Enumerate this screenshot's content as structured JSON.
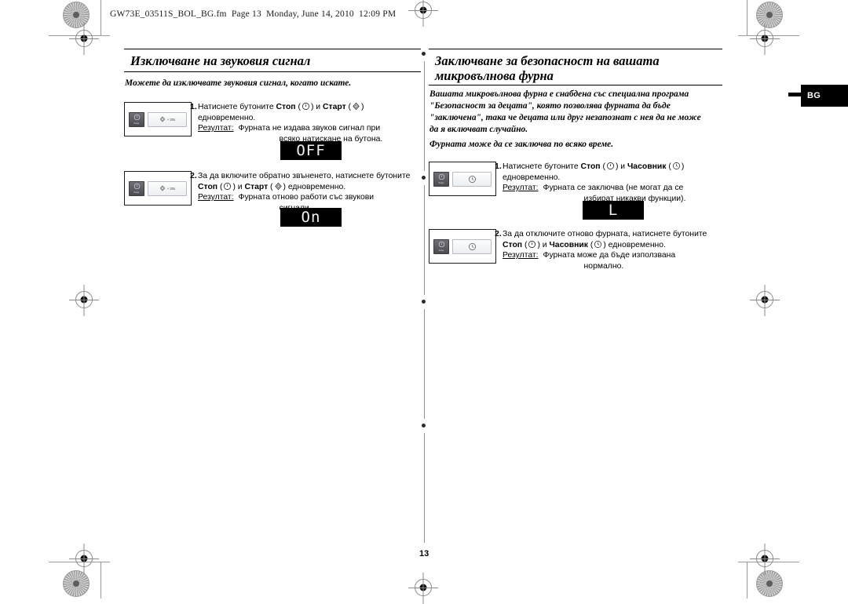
{
  "document": {
    "fm_header": "GW73E_03511S_BOL_BG.fm  Page 13  Monday, June 14, 2010  12:09 PM",
    "page_number": "13",
    "language_tab": "BG"
  },
  "left_column": {
    "title": "Изключване на звуковия сигнал",
    "lead": "Можете да изключвате звуковия сигнал, когато искате.",
    "steps": [
      {
        "number": "1.",
        "line1_pre": "Натиснете бутоните ",
        "btn1": "Стоп",
        "btn1_symbol": "stop-icon",
        "mid": " и ",
        "btn2": "Старт",
        "btn2_symbol": "start-icon",
        "line1_post": "",
        "line2": "едновременно.",
        "result_label": "Резултат:",
        "result_line1": "Фурната не издава звуков сигнал при",
        "result_line2": "всяко натискане на бутона.",
        "panel": {
          "stop_label": "Stop",
          "wide_label": "+ 30s",
          "wide_symbol": "start-icon"
        },
        "display": "OFF"
      },
      {
        "number": "2.",
        "line1_pre": "За да включите обратно звъненето, натиснете бутоните",
        "btn1": "Стоп",
        "btn1_symbol": "stop-icon",
        "mid": " и ",
        "btn2": "Старт",
        "btn2_symbol": "start-icon",
        "line1_post": " едновременно.",
        "line2": "",
        "result_label": "Резултат:",
        "result_line1": "Фурната отново работи със звукови",
        "result_line2": "сигнали.",
        "panel": {
          "stop_label": "Stop",
          "wide_label": "+ 30s",
          "wide_symbol": "start-icon"
        },
        "display": "On"
      }
    ]
  },
  "right_column": {
    "title_line1": "Заключване за безопасност на вашата",
    "title_line2": "микровълнова фурна",
    "lead_lines": [
      "Вашата микровълнова фурна е снабдена със специална програма",
      "\"Безопасност за децата\", която позволява фурната да бъде",
      "\"заключена\", така че децата или друг незапознат с нея да не може",
      "да я включват случайно."
    ],
    "lead2": "Фурната може да се заключва по всяко време.",
    "steps": [
      {
        "number": "1.",
        "line1_pre": "Натиснете бутоните ",
        "btn1": "Стоп",
        "btn1_symbol": "stop-icon",
        "mid": " и ",
        "btn2": "Часовник",
        "btn2_symbol": "clock-icon",
        "line1_post": "",
        "line2": "едновременно.",
        "result_label": "Резултат:",
        "result_line1": "Фурната се заключва (не могат да се",
        "result_line2": "избират никакви функции).",
        "panel": {
          "stop_label": "Stop",
          "wide_symbol": "clock-icon"
        },
        "display": "L"
      },
      {
        "number": "2.",
        "line1_pre": "За да отключите отново фурната, натиснете бутоните",
        "btn1": "Стоп",
        "btn1_symbol": "stop-icon",
        "mid": " и ",
        "btn2": "Часовник",
        "btn2_symbol": "clock-icon",
        "line1_post": " едновременно.",
        "line2": "",
        "result_label": "Резултат:",
        "result_line1": "Фурната може да бъде използвана",
        "result_line2": "нормално.",
        "panel": {
          "stop_label": "Stop",
          "wide_symbol": "clock-icon"
        },
        "display": ""
      }
    ]
  }
}
